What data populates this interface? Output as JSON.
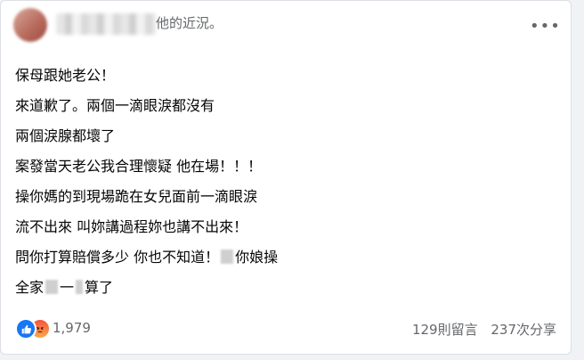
{
  "post": {
    "header_suffix": "他的近況。",
    "more_label": "•••",
    "lines": [
      "保母跟她老公！",
      "來道歉了。兩個一滴眼淚都沒有",
      "兩個淚腺都壞了",
      "案發當天老公我合理懷疑 他在場！！！",
      "操你媽的到現場跪在女兒面前一滴眼淚",
      "流不出來 叫妳講過程妳也講不出來！",
      "問你打算賠償多少 你也不知道！",
      "你娘操",
      "全家",
      "一",
      "算了"
    ]
  },
  "footer": {
    "reaction_count": "1,979",
    "comments": "129則留言",
    "shares": "237次分享"
  },
  "icons": {
    "like": "like-icon",
    "angry": "angry-icon",
    "more": "more-options-icon"
  },
  "colors": {
    "like_blue": "#1877f2",
    "secondary_text": "#65676b"
  }
}
